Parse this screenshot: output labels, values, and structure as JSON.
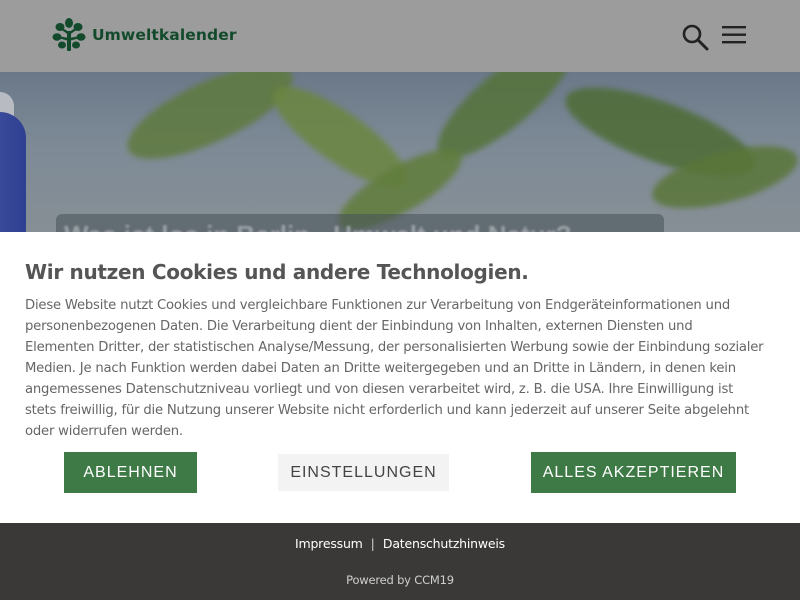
{
  "header": {
    "logo_text": "Umweltkalender",
    "icons": [
      "tree-logo-icon",
      "search-icon",
      "menu-icon"
    ]
  },
  "hero": {
    "title": "Was ist los in Berlin - Umwelt und Natur?"
  },
  "cookie": {
    "title": "Wir nutzen Cookies und andere Technologien.",
    "text": "Diese Website nutzt Cookies und vergleichbare Funktionen zur Verarbeitung von Endgeräteinformationen und personenbezogenen Daten. Die Verarbeitung dient der Einbindung von Inhalten, externen Diensten und Elementen Dritter, der statistischen Analyse/Messung, der personalisierten Werbung sowie der Einbindung sozialer Medien. Je nach Funktion werden dabei Daten an Dritte weitergegeben und an Dritte in Ländern, in denen kein angemessenes Datenschutzniveau vorliegt und von diesen verarbeitet wird, z. B. die USA. Ihre Einwilligung ist stets freiwillig, für die Nutzung unserer Website nicht erforderlich und kann jederzeit auf unserer Seite abgelehnt oder widerrufen werden.",
    "reject_label": "ABLEHNEN",
    "settings_label": "EINSTELLUNGEN",
    "accept_label": "ALLES AKZEPTIEREN"
  },
  "footer": {
    "impressum": "Impressum",
    "separator": "|",
    "privacy": "Datenschutzhinweis",
    "powered": "Powered by CCM19"
  },
  "colors": {
    "brand_green": "#134a2c",
    "button_green": "#3e7a46",
    "footer_bg": "#3a3938"
  }
}
